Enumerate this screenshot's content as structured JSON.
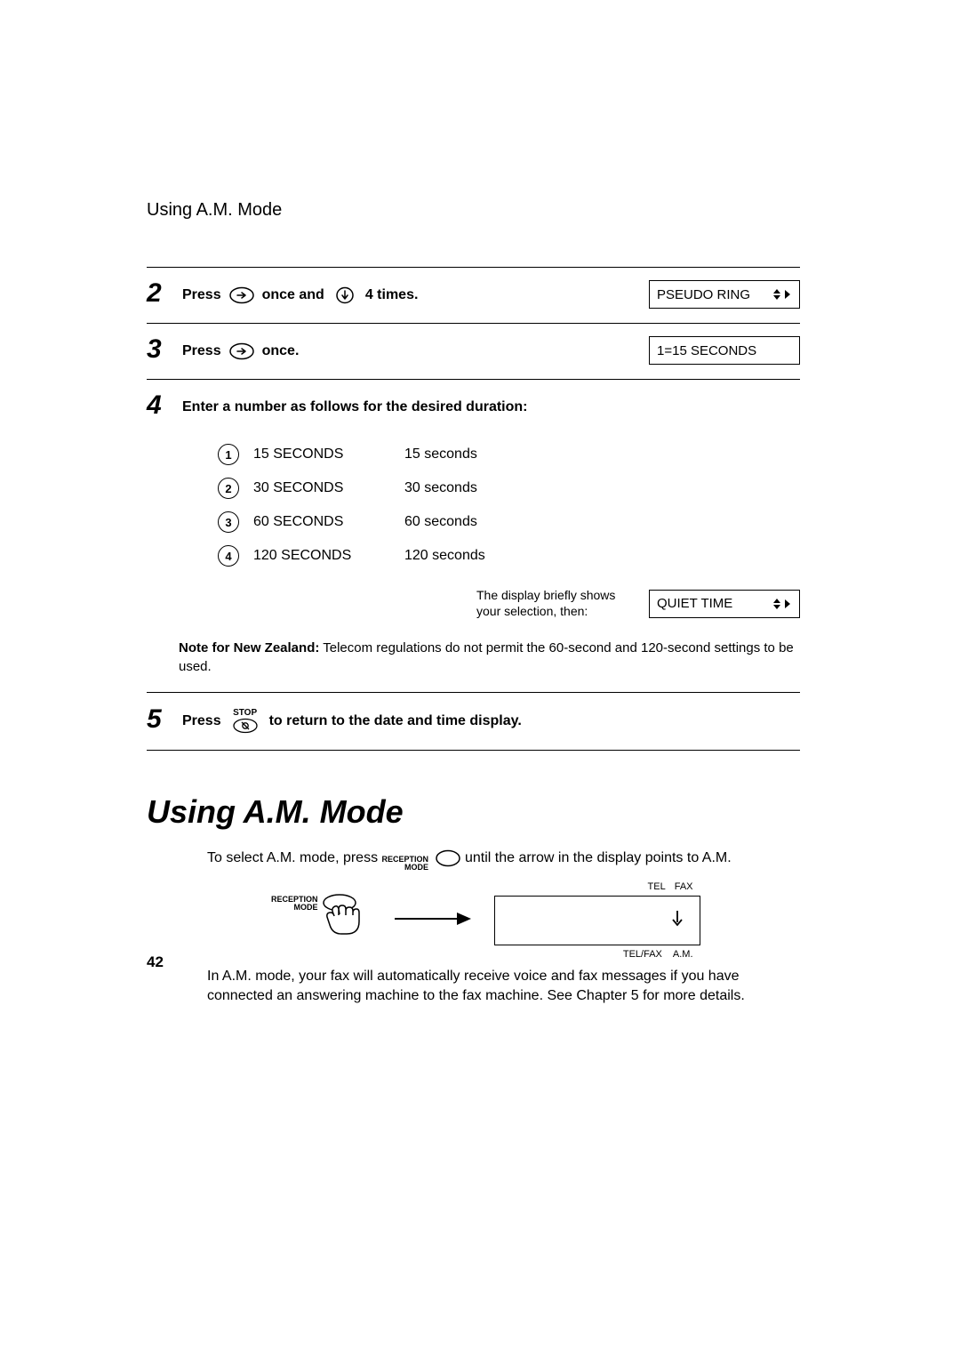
{
  "runningHeader": "Using A.M. Mode",
  "pageNumber": "42",
  "step2": {
    "num": "2",
    "t1": "Press",
    "t2": "once and",
    "t3": "4 times.",
    "lcd": "PSEUDO RING"
  },
  "step3": {
    "num": "3",
    "t1": "Press",
    "t2": "once.",
    "lcd": "1=15 SECONDS"
  },
  "step4": {
    "num": "4",
    "heading": "Enter a number as follows for the desired duration:",
    "rows": [
      {
        "key": "1",
        "label": "15 SECONDS",
        "desc": "15 seconds"
      },
      {
        "key": "2",
        "label": "30 SECONDS",
        "desc": "30 seconds"
      },
      {
        "key": "3",
        "label": "60 SECONDS",
        "desc": "60 seconds"
      },
      {
        "key": "4",
        "label": "120 SECONDS",
        "desc": "120 seconds"
      }
    ],
    "postNote": "The display briefly shows your selection, then:",
    "lcd": "QUIET TIME",
    "nzLabel": "Note for New Zealand:",
    "nzText": " Telecom regulations do not permit the 60-second and 120-second settings to be used."
  },
  "step5": {
    "num": "5",
    "t1": "Press",
    "stopLabel": "STOP",
    "t2": "to return to the date and time display."
  },
  "section": {
    "title": "Using A.M. Mode",
    "p1a": "To select A.M. mode, press ",
    "receptionTop": "RECEPTION",
    "receptionBot": "MODE",
    "p1b": " until the arrow in the display points to A.M.",
    "lcdTop": {
      "a": "TEL",
      "b": "FAX"
    },
    "lcdBot": {
      "a": "TEL/FAX",
      "b": "A.M."
    },
    "p2": "In A.M. mode, your fax will automatically receive voice and fax messages if you have connected an answering machine to the fax machine. See Chapter 5 for more details."
  }
}
